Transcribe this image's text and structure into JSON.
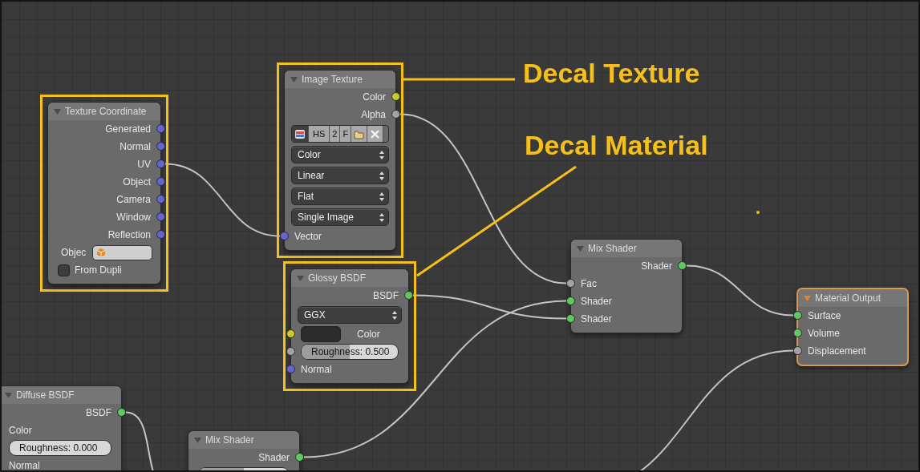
{
  "nodes": [
    {
      "title": "Texture Coordinate",
      "active": false,
      "highlighted": true,
      "rows": [
        {
          "kind": "output",
          "label": "Generated",
          "color": "#6565cf"
        },
        {
          "kind": "output",
          "label": "Normal",
          "color": "#6565cf"
        },
        {
          "kind": "output",
          "label": "UV",
          "color": "#6565cf"
        },
        {
          "kind": "output",
          "label": "Object",
          "color": "#6565cf"
        },
        {
          "kind": "output",
          "label": "Camera",
          "color": "#6565cf"
        },
        {
          "kind": "output",
          "label": "Window",
          "color": "#6565cf"
        },
        {
          "kind": "output",
          "label": "Reflection",
          "color": "#6565cf"
        },
        {
          "kind": "object-field",
          "label": "Objec"
        },
        {
          "kind": "checkbox",
          "label": "From Dupli",
          "checked": false
        }
      ]
    },
    {
      "title": "Image Texture",
      "active": false,
      "highlighted": true,
      "rows": [
        {
          "kind": "output",
          "label": "Color",
          "color": "#c9c92c"
        },
        {
          "kind": "output",
          "label": "Alpha",
          "color": "#a3a3a3"
        },
        {
          "kind": "toolbar",
          "items": [
            {
              "kind": "image-icon"
            },
            {
              "kind": "text",
              "label": "HS"
            },
            {
              "kind": "text",
              "label": "2"
            },
            {
              "kind": "text",
              "label": "F"
            },
            {
              "kind": "pack-icon"
            },
            {
              "kind": "close-icon"
            }
          ]
        },
        {
          "kind": "dropdown",
          "label": "Color"
        },
        {
          "kind": "dropdown",
          "label": "Linear"
        },
        {
          "kind": "dropdown",
          "label": "Flat"
        },
        {
          "kind": "dropdown",
          "label": "Single Image"
        },
        {
          "kind": "input",
          "label": "Vector",
          "color": "#6565cf"
        }
      ]
    },
    {
      "title": "Glossy BSDF",
      "active": false,
      "highlighted": true,
      "rows": [
        {
          "kind": "output",
          "label": "BSDF",
          "color": "#5fc95f"
        },
        {
          "kind": "dropdown",
          "label": "GGX"
        },
        {
          "kind": "color-input",
          "label": "Color",
          "color": "#c9c92c"
        },
        {
          "kind": "slider",
          "label": "Roughness: 0.500",
          "level": 0.5,
          "color": "#a3a3a3"
        },
        {
          "kind": "input",
          "label": "Normal",
          "color": "#6565cf"
        }
      ]
    },
    {
      "title": "Mix Shader",
      "active": false,
      "highlighted": false,
      "rows": [
        {
          "kind": "output",
          "label": "Shader",
          "color": "#5fc95f"
        },
        {
          "kind": "input",
          "label": "Fac",
          "color": "#a3a3a3"
        },
        {
          "kind": "input",
          "label": "Shader",
          "color": "#5fc95f"
        },
        {
          "kind": "input",
          "label": "Shader",
          "color": "#5fc95f"
        }
      ]
    },
    {
      "title": "Material Output",
      "active": true,
      "highlighted": false,
      "rows": [
        {
          "kind": "input",
          "label": "Surface",
          "color": "#5fc95f"
        },
        {
          "kind": "input",
          "label": "Volume",
          "color": "#5fc95f"
        },
        {
          "kind": "input",
          "label": "Displacement",
          "color": "#a3a3a3"
        }
      ]
    },
    {
      "title": "Diffuse BSDF",
      "active": false,
      "highlighted": false,
      "rows": [
        {
          "kind": "output",
          "label": "BSDF",
          "color": "#5fc95f"
        },
        {
          "kind": "input",
          "label": "Color"
        },
        {
          "kind": "slider",
          "label": "Roughness: 0.000",
          "level": 0
        },
        {
          "kind": "input",
          "label": "Normal"
        }
      ]
    },
    {
      "title": "Mix Shader",
      "active": false,
      "highlighted": false,
      "rows": [
        {
          "kind": "output",
          "label": "Shader",
          "color": "#5fc95f"
        },
        {
          "kind": "slider",
          "level": 0.5
        }
      ]
    }
  ],
  "annotations": [
    {
      "label": "Decal Texture"
    },
    {
      "label": "Decal Material"
    }
  ]
}
